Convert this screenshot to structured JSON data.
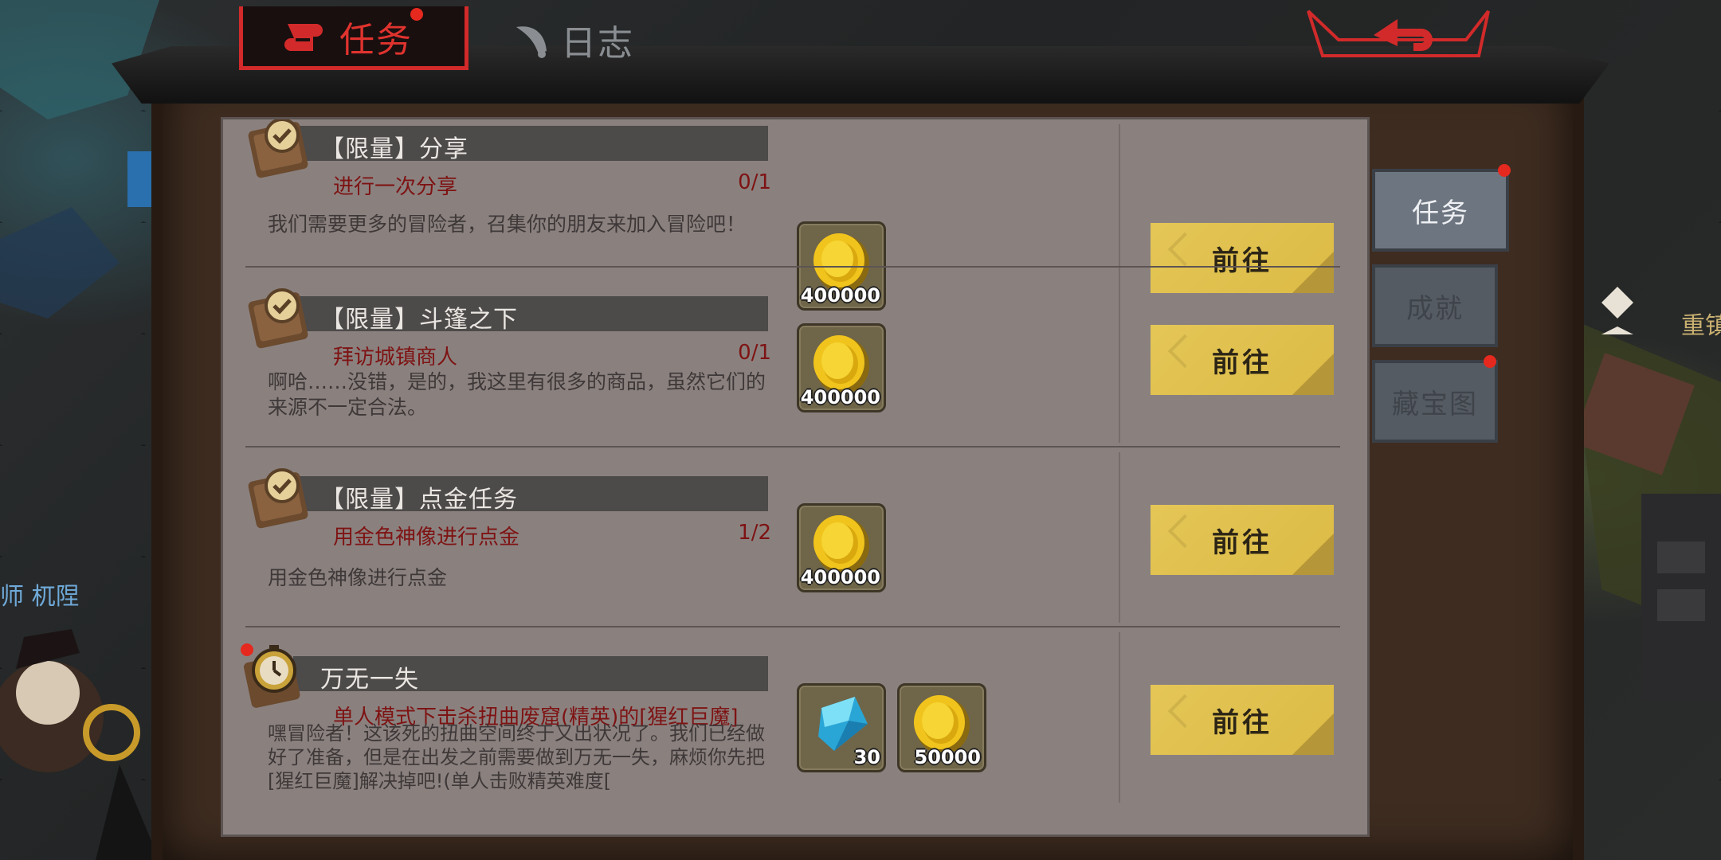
{
  "tabs": {
    "task_label": "任务",
    "log_label": "日志"
  },
  "quests": [
    {
      "title": "【限量】分享",
      "objective": "进行一次分享",
      "progress": "0/1",
      "description": "我们需要更多的冒险者，召集你的朋友来加入冒险吧！",
      "rewards": [
        {
          "icon": "gold-coin-icon",
          "amount": "400000"
        }
      ],
      "button": "前往",
      "notification": false
    },
    {
      "title": "【限量】斗篷之下",
      "objective": "拜访城镇商人",
      "progress": "0/1",
      "description": "啊哈……没错，是的，我这里有很多的商品，虽然它们的来源不一定合法。",
      "rewards": [
        {
          "icon": "gold-coin-icon",
          "amount": "400000"
        }
      ],
      "button": "前往",
      "notification": false
    },
    {
      "title": "【限量】点金任务",
      "objective": "用金色神像进行点金",
      "progress": "1/2",
      "description": "用金色神像进行点金",
      "rewards": [
        {
          "icon": "gold-coin-icon",
          "amount": "400000"
        }
      ],
      "button": "前往",
      "notification": false
    },
    {
      "title": "万无一失",
      "objective": "单人模式下击杀扭曲废窟(精英)的[猩红巨魔]",
      "progress": "",
      "description": "嘿冒险者！这该死的扭曲空间终于又出状况了。我们已经做好了准备，但是在出发之前需要做到万无一失，麻烦你先把[猩红巨魔]解决掉吧!(单人击败精英难度[",
      "rewards": [
        {
          "icon": "blue-crystal-icon",
          "amount": "30"
        },
        {
          "icon": "gold-coin-icon",
          "amount": "50000"
        }
      ],
      "button": "前往",
      "notification": true
    }
  ],
  "side_tabs": [
    {
      "label": "任务",
      "state": "active",
      "notification": true
    },
    {
      "label": "成就",
      "state": "inactive",
      "notification": false
    },
    {
      "label": "藏宝图",
      "state": "inactive",
      "notification": true
    }
  ],
  "scene": {
    "right_text": "重镇",
    "left_text": "师 杌陧"
  },
  "colors": {
    "accent_red": "#e0332e",
    "button_gold": "#e4c657",
    "panel_bg": "#8a817f",
    "objective_red": "#7e1313"
  }
}
